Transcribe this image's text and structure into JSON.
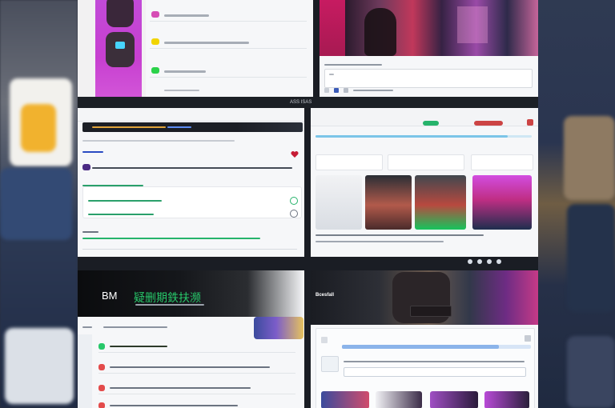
{
  "background": {
    "left_colors": [
      "#4a4f5d",
      "#6b6f79",
      "#2d3a55",
      "#1f2a44"
    ],
    "right_colors": [
      "#2f3a52",
      "#2a3550",
      "#6f5d44",
      "#263048",
      "#1f2a40"
    ]
  },
  "top_left": {
    "list_items": [
      {
        "badge_color": "#d64db5"
      },
      {
        "badge_color": "#f1d400"
      },
      {
        "badge_color": "#2bd24a"
      }
    ]
  },
  "top_right": {},
  "middle_left": {
    "brand_colors": [
      "#1b2a6e",
      "#e0a33b"
    ],
    "alert_icon": "heart-icon"
  },
  "middle_right": {
    "status_colors": [
      "#26b36b",
      "#c44"
    ]
  },
  "center_strip": {
    "label": "ASS ISAS"
  },
  "bottom_left": {
    "title": "BM",
    "headline": "疑删期鉄扶濒",
    "brand_colors": [
      "#111",
      "#2e3b2a"
    ],
    "accent_green": "#27c86a"
  },
  "bottom_right": {
    "hero_label": "Bcesfall"
  }
}
